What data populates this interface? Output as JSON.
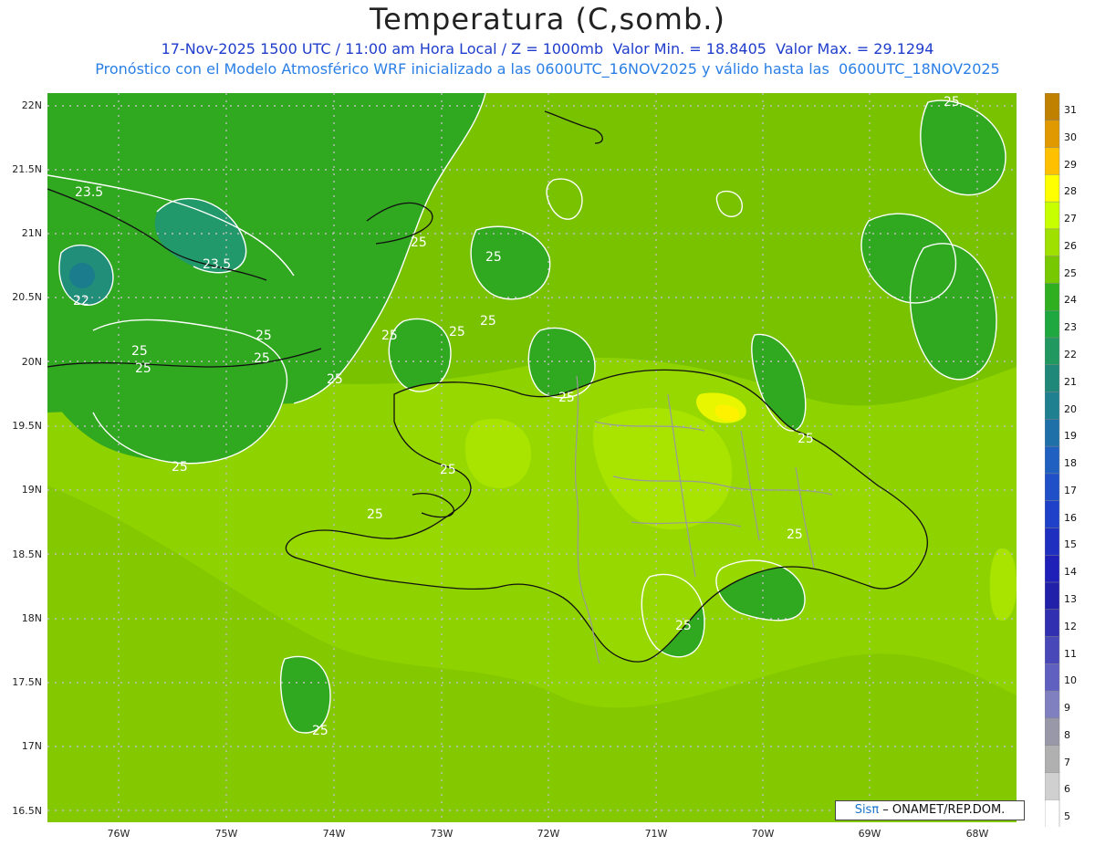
{
  "title": "Temperatura (C,somb.)",
  "subtitle_line1": "17-Nov-2025 1500 UTC / 11:00 am Hora Local / Z = 1000mb  Valor Min. = 18.8405  Valor Max. = 29.1294",
  "subtitle_line2": "Pronóstico con el Modelo Atmosférico WRF inicializado a las 0600UTC_16NOV2025 y válido hasta las  0600UTC_18NOV2025",
  "credit": {
    "brand": "Sisπ",
    "text": " – ONAMET/REP.DOM."
  },
  "lat_labels": [
    "22N",
    "21.5N",
    "21N",
    "20.5N",
    "20N",
    "19.5N",
    "19N",
    "18.5N",
    "18N",
    "17.5N",
    "17N",
    "16.5N"
  ],
  "lon_labels": [
    "76W",
    "75W",
    "74W",
    "73W",
    "72W",
    "71W",
    "70W",
    "69W",
    "68W"
  ],
  "contour_labels": [
    "23.5",
    "23.5",
    "22",
    "25",
    "25",
    "25",
    "25",
    "25",
    "25",
    "25",
    "25",
    "25",
    "25",
    "25",
    "25",
    "25",
    "25",
    "25",
    "25",
    "25",
    "25",
    "25"
  ],
  "legend_levels": [
    "31",
    "30",
    "29",
    "28",
    "27",
    "26",
    "25",
    "24",
    "23",
    "22",
    "21",
    "20",
    "19",
    "18",
    "17",
    "16",
    "15",
    "14",
    "13",
    "12",
    "11",
    "10",
    "9",
    "8",
    "7",
    "6",
    "5"
  ],
  "legend_colors": [
    "#c08000",
    "#e09a00",
    "#ffc000",
    "#ffff00",
    "#c8ff00",
    "#a0e000",
    "#78c800",
    "#30b020",
    "#20a840",
    "#209860",
    "#208878",
    "#1f8090",
    "#1f70a8",
    "#1f60c0",
    "#1f50c8",
    "#1f40c8",
    "#1f30c0",
    "#1f20b8",
    "#2020a8",
    "#3030b0",
    "#4848b8",
    "#6060c0",
    "#8080c0",
    "#9898a8",
    "#b0b0b0",
    "#d0d0d0",
    "#ffffff"
  ],
  "colors": {
    "sea": "#86c800",
    "deep_green": "#30a820",
    "teal": "#20907a",
    "land": "#9ad800",
    "hot": "#ffff00",
    "contour": "#ffffff",
    "border": "#9a9a9a",
    "coast": "#111111"
  }
}
